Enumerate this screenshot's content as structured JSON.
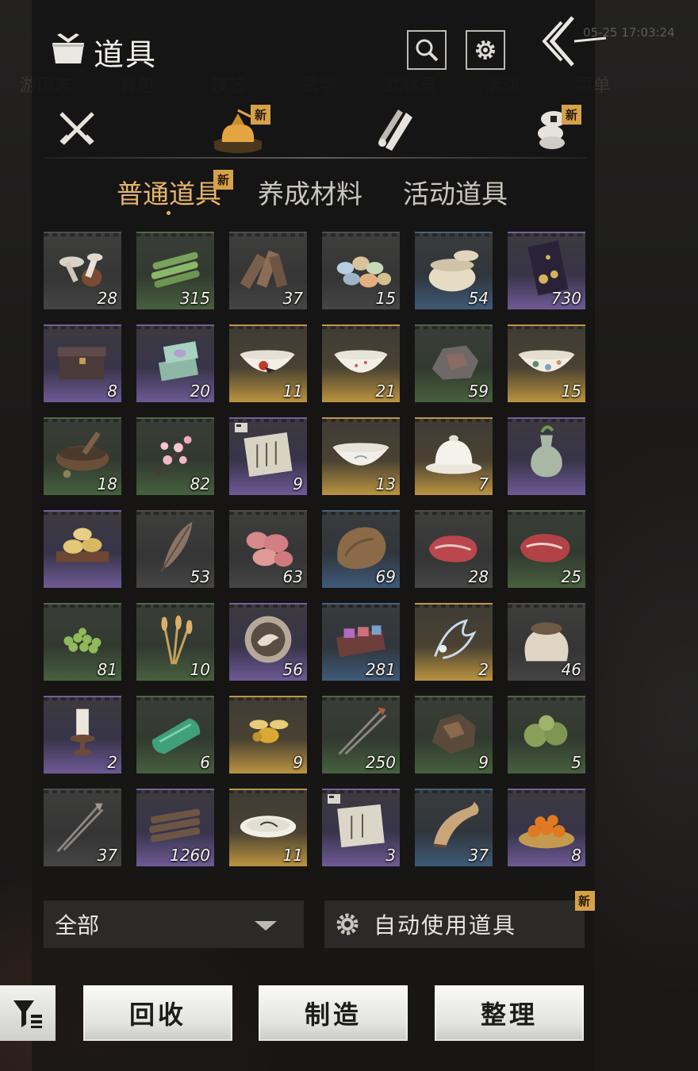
{
  "header": {
    "title": "道具",
    "timestamp": "05-25 17:03:24",
    "bg_nav": [
      "游历志",
      "背包",
      "技艺",
      "武学",
      "武林录",
      "活动",
      "菜单"
    ]
  },
  "category_tabs": [
    {
      "icon": "crossed-swords-icon",
      "new": false
    },
    {
      "icon": "item-pouch-icon",
      "new": true,
      "active": true
    },
    {
      "icon": "scroll-icon",
      "new": false
    },
    {
      "icon": "coin-stack-icon",
      "new": true
    }
  ],
  "new_badge": "新",
  "subtabs": [
    {
      "label": "普通道具",
      "active": true,
      "new": true
    },
    {
      "label": "养成材料",
      "active": false,
      "new": false
    },
    {
      "label": "活动道具",
      "active": false,
      "new": false
    }
  ],
  "items": [
    {
      "art": "mushroom",
      "qty": "28",
      "rarity": "grey"
    },
    {
      "art": "bamboo",
      "qty": "315",
      "rarity": "green"
    },
    {
      "art": "wood-pile",
      "qty": "37",
      "rarity": "grey"
    },
    {
      "art": "eggs",
      "qty": "15",
      "rarity": "grey"
    },
    {
      "art": "jar",
      "qty": "54",
      "rarity": "blue"
    },
    {
      "art": "invitation-card",
      "qty": "730",
      "rarity": "purple"
    },
    {
      "art": "chest",
      "qty": "8",
      "rarity": "purple"
    },
    {
      "art": "gift-box",
      "qty": "20",
      "rarity": "purple"
    },
    {
      "art": "rooster-bowl",
      "qty": "11",
      "rarity": "gold"
    },
    {
      "art": "white-bowl",
      "qty": "21",
      "rarity": "gold"
    },
    {
      "art": "ore-stone",
      "qty": "59",
      "rarity": "green"
    },
    {
      "art": "flower-bowl",
      "qty": "15",
      "rarity": "gold"
    },
    {
      "art": "mortar",
      "qty": "18",
      "rarity": "green"
    },
    {
      "art": "plum-blossom",
      "qty": "82",
      "rarity": "green"
    },
    {
      "art": "letter",
      "qty": "9",
      "rarity": "purple",
      "doc": true
    },
    {
      "art": "porcelain-bowl",
      "qty": "13",
      "rarity": "gold"
    },
    {
      "art": "covered-cup",
      "qty": "7",
      "rarity": "gold"
    },
    {
      "art": "vase",
      "qty": "",
      "rarity": "purple"
    },
    {
      "art": "mooncake-tray",
      "qty": "",
      "rarity": "purple"
    },
    {
      "art": "feather",
      "qty": "53",
      "rarity": "grey"
    },
    {
      "art": "raw-meat",
      "qty": "63",
      "rarity": "grey"
    },
    {
      "art": "fur-pelt",
      "qty": "69",
      "rarity": "blue"
    },
    {
      "art": "steak",
      "qty": "28",
      "rarity": "grey"
    },
    {
      "art": "steak-2",
      "qty": "25",
      "rarity": "green"
    },
    {
      "art": "green-beans",
      "qty": "81",
      "rarity": "green"
    },
    {
      "art": "wheat",
      "qty": "10",
      "rarity": "green"
    },
    {
      "art": "crane-token",
      "qty": "56",
      "rarity": "purple"
    },
    {
      "art": "powder-box",
      "qty": "281",
      "rarity": "blue"
    },
    {
      "art": "spirit-wisp",
      "qty": "2",
      "rarity": "gold"
    },
    {
      "art": "grain-sack",
      "qty": "46",
      "rarity": "grey"
    },
    {
      "art": "candle",
      "qty": "2",
      "rarity": "purple"
    },
    {
      "art": "jade-tile",
      "qty": "6",
      "rarity": "green"
    },
    {
      "art": "golden-bee",
      "qty": "9",
      "rarity": "gold"
    },
    {
      "art": "arrows",
      "qty": "250",
      "rarity": "green"
    },
    {
      "art": "dark-ore",
      "qty": "9",
      "rarity": "green"
    },
    {
      "art": "chestnut-burr",
      "qty": "5",
      "rarity": "green"
    },
    {
      "art": "spear-arrows",
      "qty": "37",
      "rarity": "grey"
    },
    {
      "art": "firewood",
      "qty": "1260",
      "rarity": "purple"
    },
    {
      "art": "ink-plate",
      "qty": "11",
      "rarity": "gold"
    },
    {
      "art": "letter-2",
      "qty": "3",
      "rarity": "purple",
      "doc": true
    },
    {
      "art": "horn",
      "qty": "37",
      "rarity": "blue"
    },
    {
      "art": "persimmon-basket",
      "qty": "8",
      "rarity": "purple"
    }
  ],
  "filter": {
    "selected": "全部"
  },
  "auto_use": {
    "label": "自动使用道具",
    "new": true
  },
  "actions": {
    "recycle": "回收",
    "craft": "制造",
    "sort": "整理"
  },
  "colors": {
    "accent": "#e6b56a",
    "badge": "#d7a14a"
  }
}
